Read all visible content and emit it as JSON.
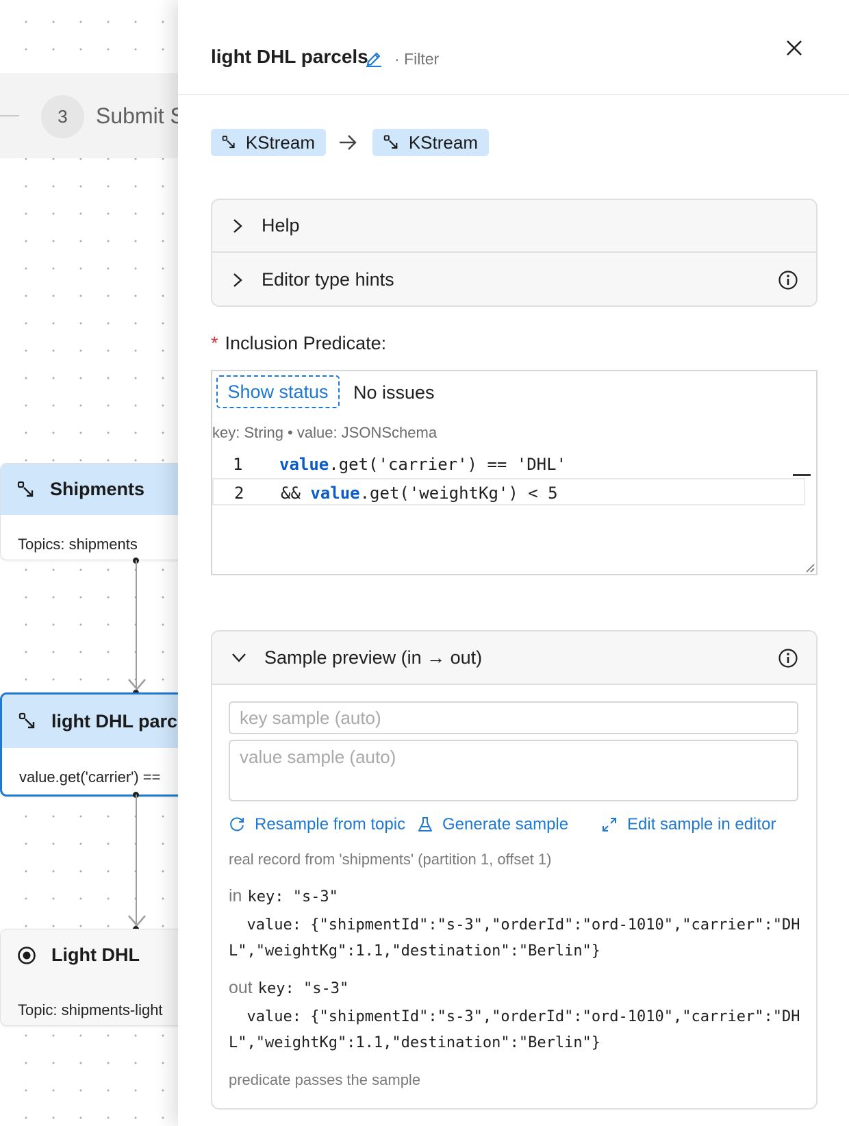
{
  "step": {
    "number": "3",
    "label": "Submit S"
  },
  "nodes": {
    "shipments": {
      "title": "Shipments",
      "subtitle": "Topics: shipments"
    },
    "filter": {
      "title": "light DHL parc.",
      "subtitle": "value.get('carrier') =="
    },
    "sink": {
      "title": "Light DHL",
      "subtitle": "Topic: shipments-light"
    }
  },
  "panel": {
    "title": "light DHL parcels",
    "subtitle": "· Filter",
    "input_type": "KStream",
    "output_type": "KStream",
    "accordion": {
      "help": "Help",
      "hints": "Editor type hints"
    },
    "predicate_required_mark": "*",
    "predicate_label": "Inclusion Predicate:",
    "editor": {
      "show_status": "Show status",
      "status": "No issues",
      "type_line": "key: String • value: JSONSchema",
      "lines": [
        {
          "number": "1",
          "kw": "value",
          "rest": ".get('carrier') == 'DHL'"
        },
        {
          "number": "2",
          "pre": "&& ",
          "kw": "value",
          "rest": ".get('weightKg') < 5"
        }
      ]
    },
    "preview": {
      "title": "Sample preview (in → out)",
      "key_placeholder": "key sample (auto)",
      "value_placeholder": "value sample (auto)",
      "actions": {
        "resample": "Resample from topic",
        "generate": "Generate sample",
        "edit": "Edit sample in editor"
      },
      "source_note": "real record from 'shipments' (partition 1, offset 1)",
      "in": {
        "tag": "in",
        "key": "key: \"s-3\"",
        "value": "  value: {\"shipmentId\":\"s-3\",\"orderId\":\"ord-1010\",\"carrier\":\"DHL\",\"weightKg\":1.1,\"destination\":\"Berlin\"}"
      },
      "out": {
        "tag": "out",
        "key": "key: \"s-3\"",
        "value": "  value: {\"shipmentId\":\"s-3\",\"orderId\":\"ord-1010\",\"carrier\":\"DHL\",\"weightKg\":1.1,\"destination\":\"Berlin\"}"
      },
      "result_note": "predicate passes the sample"
    }
  },
  "colors": {
    "accent": "#1f78d1",
    "chip": "#cfe6fb",
    "required": "#d13438",
    "keyword": "#0b5cc4"
  },
  "icons": [
    "stream-icon",
    "sink-icon",
    "edit-icon",
    "close-icon",
    "arrow-right-icon",
    "chevron-right-icon",
    "chevron-down-icon",
    "info-icon",
    "refresh-icon",
    "flask-icon",
    "expand-icon",
    "resize-grip-icon"
  ]
}
